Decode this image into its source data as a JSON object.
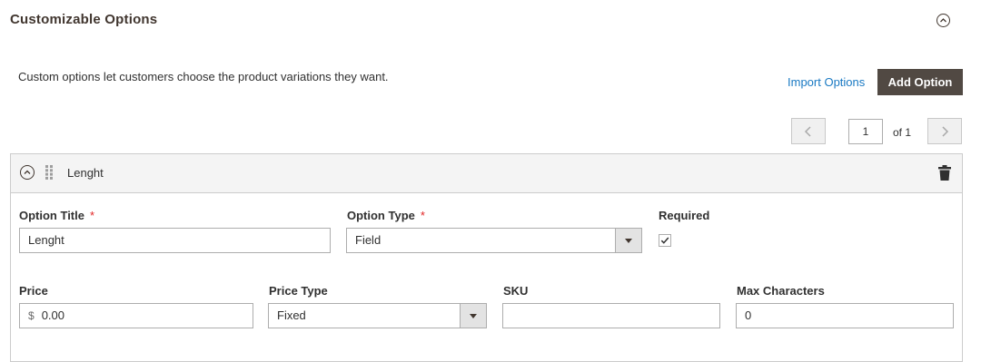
{
  "section": {
    "title": "Customizable Options",
    "description": "Custom options let customers choose the product variations they want."
  },
  "actions": {
    "import_label": "Import Options",
    "add_label": "Add Option"
  },
  "pager": {
    "current_page": "1",
    "of_label": "of 1"
  },
  "option": {
    "header_title": "Lenght",
    "fields": {
      "option_title_label": "Option Title",
      "option_title_value": "Lenght",
      "option_type_label": "Option Type",
      "option_type_value": "Field",
      "required_label": "Required",
      "required_checked": true,
      "required_star": "*",
      "price_label": "Price",
      "price_currency": "$",
      "price_value": "0.00",
      "price_type_label": "Price Type",
      "price_type_value": "Fixed",
      "sku_label": "SKU",
      "sku_value": "",
      "max_characters_label": "Max Characters",
      "max_characters_value": "0"
    }
  },
  "colors": {
    "primary_button": "#514943",
    "link": "#1979c3",
    "required_star": "#e22626",
    "header_bg": "#f4f4f4"
  },
  "icons": {
    "section_collapse": "chevron-up-circle-icon",
    "row_collapse": "chevron-up-circle-icon",
    "drag": "drag-handle-icon",
    "delete": "trash-icon",
    "prev": "chevron-left-icon",
    "next": "chevron-right-icon",
    "check": "checkmark-icon"
  }
}
